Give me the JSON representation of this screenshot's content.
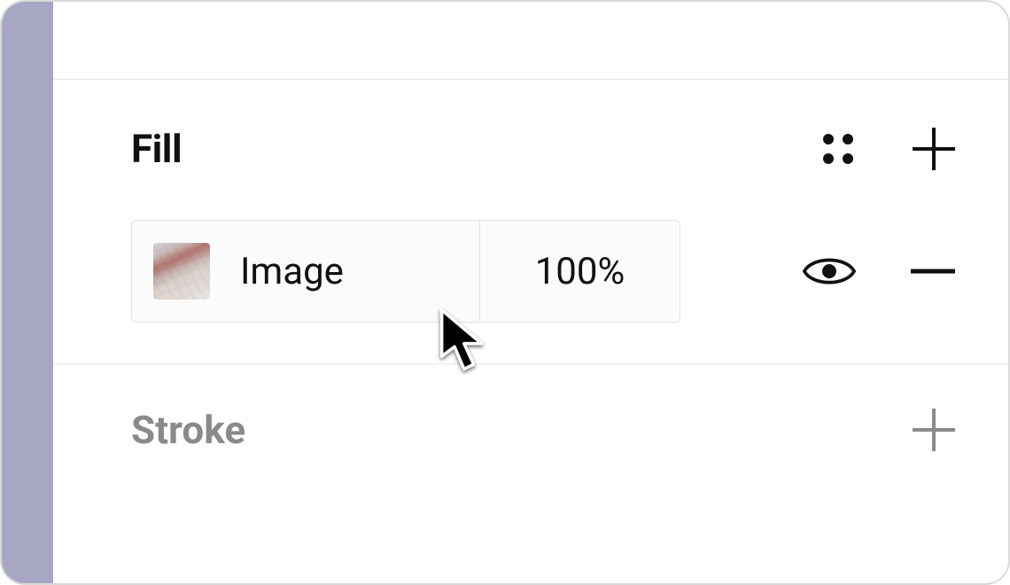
{
  "sections": {
    "fill": {
      "title": "Fill",
      "item": {
        "type_label": "Image",
        "opacity": "100%"
      }
    },
    "stroke": {
      "title": "Stroke"
    }
  },
  "colors": {
    "side_strip": "#a7a7c4",
    "border": "#e2e2e2",
    "muted": "#8a8a8a"
  },
  "icons": {
    "styles": "styles-icon",
    "add": "plus-icon",
    "visibility": "eye-icon",
    "remove": "minus-icon",
    "add_stroke": "plus-icon"
  }
}
